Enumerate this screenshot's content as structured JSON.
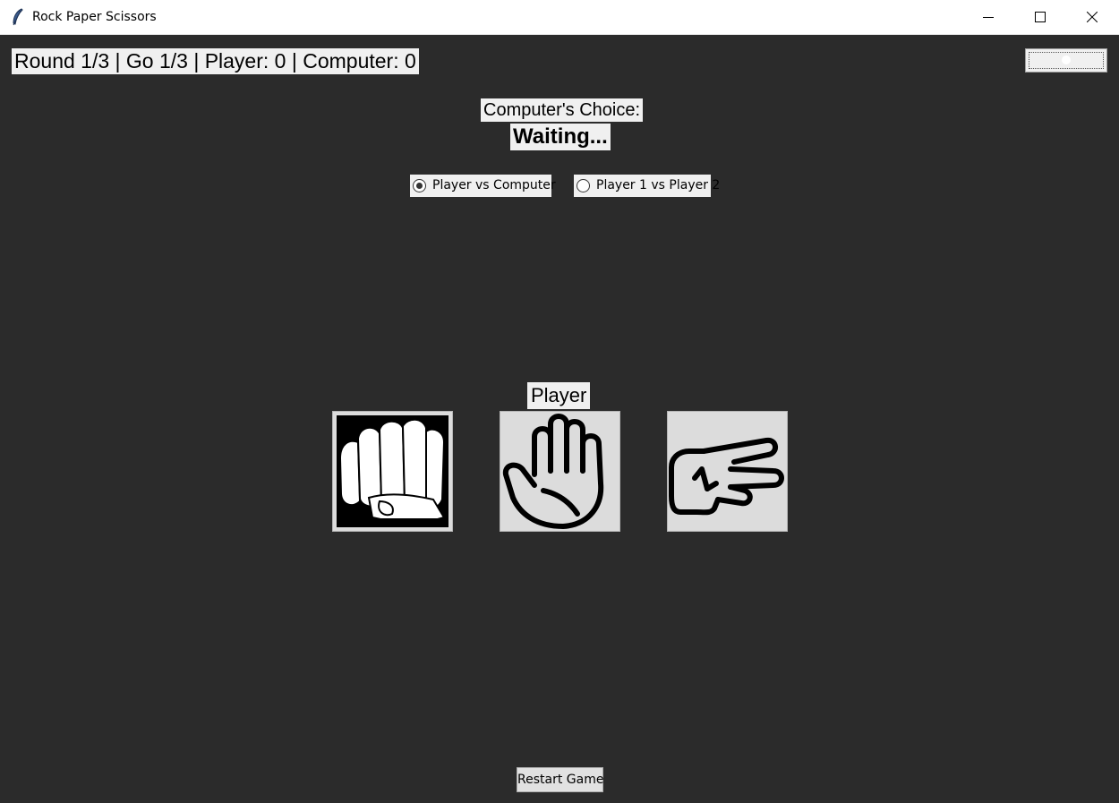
{
  "window": {
    "title": "Rock Paper Scissors",
    "app_icon": "feather-icon"
  },
  "status": {
    "text": "Round 1/3 | Go 1/3 | Player: 0 | Computer: 0"
  },
  "computer": {
    "label": "Computer's Choice:",
    "choice": "Waiting..."
  },
  "modes": [
    {
      "label": "Player vs Computer",
      "selected": true
    },
    {
      "label": "Player 1 vs Player 2",
      "selected": false
    }
  ],
  "player": {
    "label": "Player",
    "choices": [
      {
        "name": "rock",
        "icon": "fist-icon"
      },
      {
        "name": "paper",
        "icon": "open-hand-icon"
      },
      {
        "name": "scissors",
        "icon": "scissors-hand-icon"
      }
    ]
  },
  "controls": {
    "restart_label": "Restart Game"
  },
  "colors": {
    "background": "#2b2b2b",
    "panel": "#f0f0f0",
    "button_face": "#dcdcdc"
  }
}
